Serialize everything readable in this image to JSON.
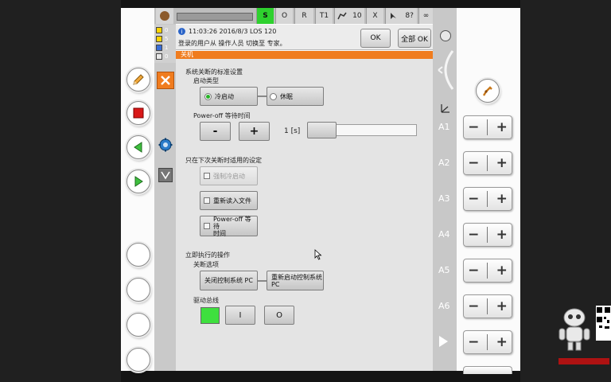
{
  "status_bar": {
    "s_label": "S",
    "o_label": "O",
    "r_label": "R",
    "t1_label": "T1",
    "speed_value": "10",
    "tool_label": "X",
    "override_label": "8?",
    "infinity_label": "∞"
  },
  "messages": {
    "counts": [
      "0",
      "5",
      "1",
      "0"
    ],
    "timestamp": "11:03:26 2016/8/3 LOS 120",
    "text": "登录的用户从 操作人员 切换至 专家。",
    "ok_label": "OK",
    "all_ok_label": "全部 OK"
  },
  "window": {
    "title": "关机"
  },
  "standard_settings": {
    "heading": "系统关断的标准设置",
    "boot_type_label": "启动类型",
    "cold_start_label": "冷启动",
    "cold_start_selected": true,
    "hibernate_label": "休眠",
    "poweroff_wait_label": "Power-off 等待时间",
    "minus_label": "-",
    "plus_label": "+",
    "wait_value": "1 [s]",
    "wait_slider_fraction": 0.0
  },
  "next_shutdown": {
    "heading": "只在下次关断时适用的设定",
    "force_cold_start_label": "强制冷启动",
    "reload_files_label": "重新读入文件",
    "poweroff_wait_line1": "Power-off 等待",
    "poweroff_wait_line2": "时间"
  },
  "immediate": {
    "heading": "立即执行的操作",
    "shutdown_options_label": "关断选项",
    "shutdown_pc_label": "关闭控制系统 PC",
    "restart_pc_line1": "重新启动控制系统",
    "restart_pc_line2": "PC",
    "drive_bus_label": "驱动总线",
    "bus_on_label": "I",
    "bus_off_label": "O",
    "bus_status_color": "#3ee03e"
  },
  "jog": {
    "axes": [
      "A1",
      "A2",
      "A3",
      "A4",
      "A5",
      "A6"
    ],
    "minus": "−",
    "plus": "+"
  },
  "colors": {
    "orange_accent": "#f07c1e",
    "drive_green": "#3ee03e",
    "s_green": "#2ed12e"
  },
  "icons": [
    "pencil-icon",
    "stop-icon",
    "play-back-icon",
    "play-forward-icon",
    "close-icon",
    "gear-icon",
    "robot-hand-icon",
    "mouse-cursor-icon"
  ]
}
